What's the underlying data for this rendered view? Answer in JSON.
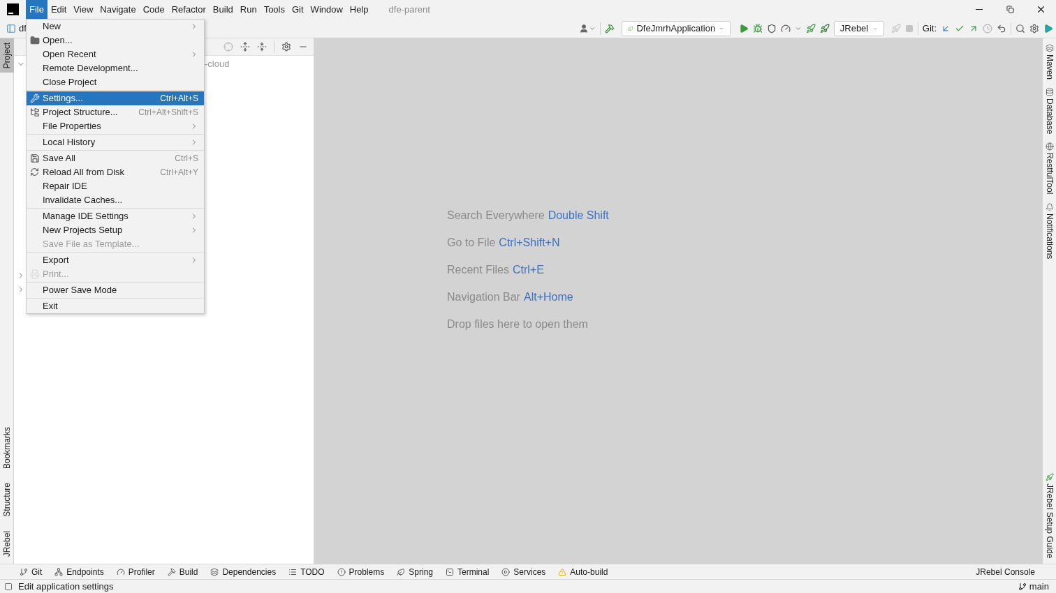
{
  "menu_bar": {
    "items": [
      {
        "label": "File",
        "selected": true
      },
      {
        "label": "Edit",
        "selected": false
      },
      {
        "label": "View",
        "selected": false
      },
      {
        "label": "Navigate",
        "selected": false
      },
      {
        "label": "Code",
        "selected": false
      },
      {
        "label": "Refactor",
        "selected": false
      },
      {
        "label": "Build",
        "selected": false
      },
      {
        "label": "Run",
        "selected": false
      },
      {
        "label": "Tools",
        "selected": false
      },
      {
        "label": "Git",
        "selected": false
      },
      {
        "label": "Window",
        "selected": false
      },
      {
        "label": "Help",
        "selected": false
      }
    ],
    "title": "dfe-parent"
  },
  "breadcrumb": "df",
  "toolbar": {
    "run_config": "DfeJmrhApplication",
    "jrebel_selector": "JRebel",
    "git_label": "Git:"
  },
  "file_menu": [
    {
      "kind": "item",
      "label": "New",
      "submenu": true,
      "disabled": false,
      "selected": false
    },
    {
      "kind": "item",
      "label": "Open...",
      "submenu": false,
      "disabled": false,
      "selected": false
    },
    {
      "kind": "item",
      "label": "Open Recent",
      "submenu": true,
      "disabled": false,
      "selected": false
    },
    {
      "kind": "item",
      "label": "Remote Development...",
      "submenu": false,
      "disabled": false,
      "selected": false
    },
    {
      "kind": "item",
      "label": "Close Project",
      "submenu": false,
      "disabled": false,
      "selected": false
    },
    {
      "kind": "separator"
    },
    {
      "kind": "item",
      "label": "Settings...",
      "shortcut": "Ctrl+Alt+S",
      "submenu": false,
      "disabled": false,
      "selected": true
    },
    {
      "kind": "item",
      "label": "Project Structure...",
      "shortcut": "Ctrl+Alt+Shift+S",
      "submenu": false,
      "disabled": false,
      "selected": false
    },
    {
      "kind": "item",
      "label": "File Properties",
      "submenu": true,
      "disabled": false,
      "selected": false
    },
    {
      "kind": "separator"
    },
    {
      "kind": "item",
      "label": "Local History",
      "submenu": true,
      "disabled": false,
      "selected": false
    },
    {
      "kind": "separator"
    },
    {
      "kind": "item",
      "label": "Save All",
      "shortcut": "Ctrl+S",
      "submenu": false,
      "disabled": false,
      "selected": false
    },
    {
      "kind": "item",
      "label": "Reload All from Disk",
      "shortcut": "Ctrl+Alt+Y",
      "submenu": false,
      "disabled": false,
      "selected": false
    },
    {
      "kind": "item",
      "label": "Repair IDE",
      "submenu": false,
      "disabled": false,
      "selected": false
    },
    {
      "kind": "item",
      "label": "Invalidate Caches...",
      "submenu": false,
      "disabled": false,
      "selected": false
    },
    {
      "kind": "separator"
    },
    {
      "kind": "item",
      "label": "Manage IDE Settings",
      "submenu": true,
      "disabled": false,
      "selected": false
    },
    {
      "kind": "item",
      "label": "New Projects Setup",
      "submenu": true,
      "disabled": false,
      "selected": false
    },
    {
      "kind": "item",
      "label": "Save File as Template...",
      "submenu": false,
      "disabled": true,
      "selected": false
    },
    {
      "kind": "separator"
    },
    {
      "kind": "item",
      "label": "Export",
      "submenu": true,
      "disabled": false,
      "selected": false
    },
    {
      "kind": "item",
      "label": "Print...",
      "submenu": false,
      "disabled": true,
      "selected": false
    },
    {
      "kind": "separator"
    },
    {
      "kind": "item",
      "label": "Power Save Mode",
      "submenu": false,
      "disabled": false,
      "selected": false
    },
    {
      "kind": "separator"
    },
    {
      "kind": "item",
      "label": "Exit",
      "submenu": false,
      "disabled": false,
      "selected": false
    }
  ],
  "left_tool_tabs": {
    "top": [
      {
        "label": "Project",
        "selected": true
      }
    ],
    "bottom": [
      {
        "label": "Bookmarks",
        "selected": false
      },
      {
        "label": "Structure",
        "selected": false
      },
      {
        "label": "JRebel",
        "selected": false
      }
    ]
  },
  "right_tool_tabs": {
    "top": [
      "Maven",
      "Database",
      "RestfulTool",
      "Notifications"
    ],
    "bottom": [
      "JRebel Setup Guide"
    ]
  },
  "project_tree": {
    "rows": [
      {
        "label": "-cloud",
        "expanded": true
      },
      {
        "expanded": false
      },
      {
        "expanded": false
      }
    ]
  },
  "editor_hints": [
    {
      "label": "Search Everywhere",
      "shortcut": "Double Shift"
    },
    {
      "label": "Go to File",
      "shortcut": "Ctrl+Shift+N"
    },
    {
      "label": "Recent Files",
      "shortcut": "Ctrl+E"
    },
    {
      "label": "Navigation Bar",
      "shortcut": "Alt+Home"
    },
    {
      "label": "Drop files here to open them"
    }
  ],
  "tool_windows": [
    "Git",
    "Endpoints",
    "Profiler",
    "Build",
    "Dependencies",
    "TODO",
    "Problems",
    "Spring",
    "Terminal",
    "Services",
    "Auto-build"
  ],
  "tool_windows_right": "JRebel Console",
  "status_bar": {
    "message": "Edit application settings",
    "branch": "main"
  }
}
